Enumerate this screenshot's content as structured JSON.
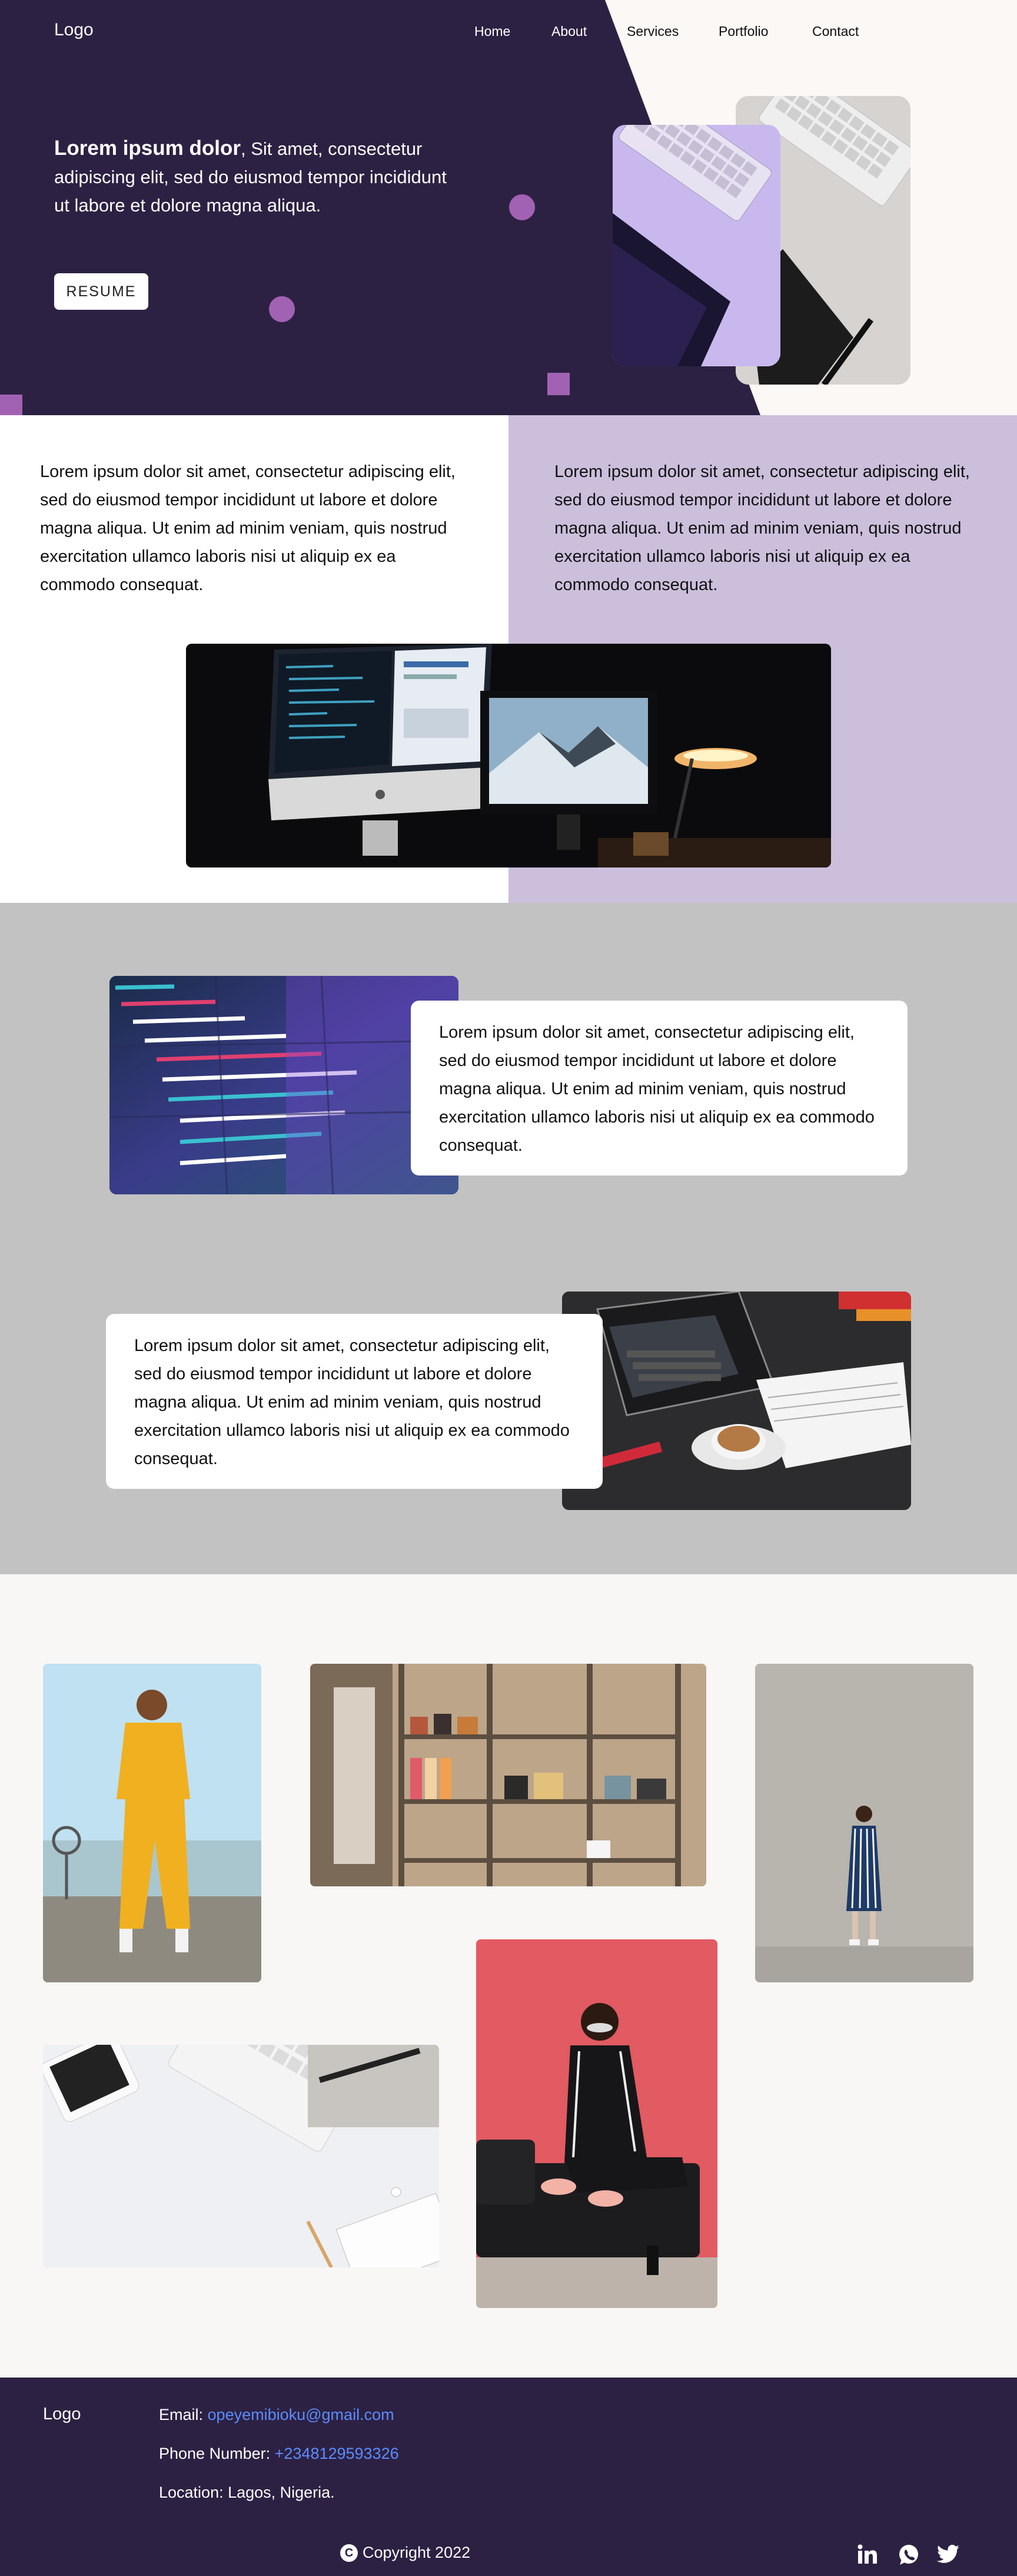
{
  "header": {
    "logo": "Logo",
    "nav": [
      "Home",
      "About",
      "Services",
      "Portfolio",
      "Contact"
    ]
  },
  "hero": {
    "title_bold": "Lorem ipsum dolor",
    "title_rest": ", Sit amet, consectetur adipiscing elit, sed do eiusmod tempor incididunt ut labore et dolore magna aliqua.",
    "resume_label": "RESUME"
  },
  "about": {
    "left_text": "Lorem ipsum dolor sit amet, consectetur adipiscing elit, sed do eiusmod tempor incididunt ut labore et dolore magna aliqua. Ut enim ad minim veniam, quis nostrud exercitation ullamco laboris nisi ut aliquip ex ea commodo consequat.",
    "right_text": "Lorem ipsum dolor sit amet, consectetur adipiscing elit, sed do eiusmod tempor incididunt ut labore et dolore magna aliqua. Ut enim ad minim veniam, quis nostrud exercitation ullamco laboris nisi ut aliquip ex ea commodo consequat."
  },
  "services": {
    "card1_text": "Lorem ipsum dolor sit amet, consectetur adipiscing elit, sed do eiusmod tempor incididunt ut labore et dolore magna aliqua. Ut enim ad minim veniam, quis nostrud exercitation ullamco laboris nisi ut aliquip ex ea commodo consequat.",
    "card2_text": "Lorem ipsum dolor sit amet, consectetur adipiscing elit, sed do eiusmod tempor incididunt ut labore et dolore magna aliqua. Ut enim ad minim veniam, quis nostrud exercitation ullamco laboris nisi ut aliquip ex ea commodo consequat."
  },
  "footer": {
    "logo": "Logo",
    "email_label": "Email:",
    "email_value": "opeyemibioku@gmail.com",
    "phone_label": "Phone Number:",
    "phone_value": "+2348129593326",
    "location": "Location: Lagos, Nigeria.",
    "copyright": "Copyright 2022",
    "social_icons": [
      "linkedin-icon",
      "whatsapp-icon",
      "twitter-icon"
    ]
  },
  "colors": {
    "dark_purple": "#2d2143",
    "lavender": "#cbbfdc",
    "accent_purple": "#a262b4",
    "gray_section": "#c2c2c2",
    "link_blue": "#5b8cff"
  }
}
